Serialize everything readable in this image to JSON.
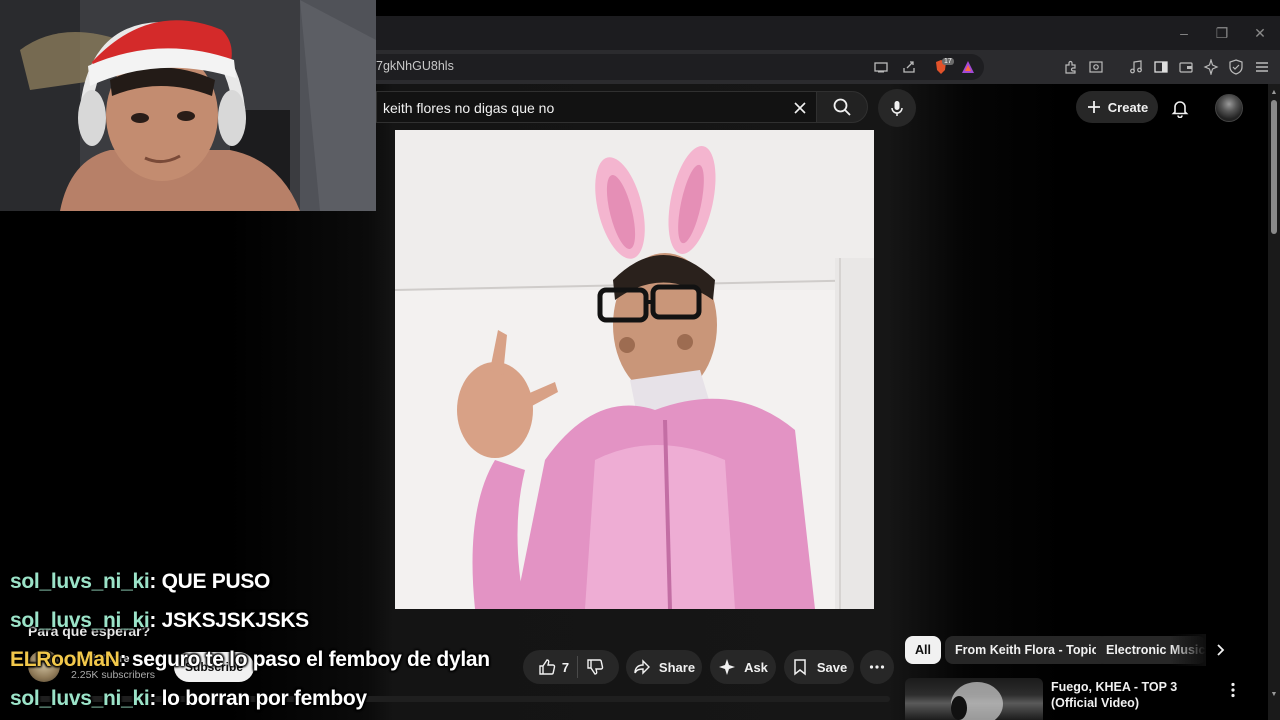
{
  "browser": {
    "url": "7gkNhGU8hls",
    "window_controls": [
      "–",
      "❐",
      "✕"
    ],
    "toolbar_icons": [
      "cast-icon",
      "share-icon",
      "brave-shields-icon",
      "brave-rewards-icon",
      "extensions-icon",
      "screenshot-icon",
      "music-icon",
      "sidebar-icon",
      "wallet-icon",
      "leo-ai-icon",
      "vpn-icon",
      "menu-icon"
    ],
    "brave_badge": "17"
  },
  "youtube": {
    "search_query": "keith flores no digas que no",
    "create_label": "Create",
    "video_pre_title": "Para qué esperar?",
    "channel_name": "Keith Flore",
    "channel_subs": "2.25K subscribers",
    "subscribe_label": "Subscribe",
    "actions": {
      "like_count": "7",
      "share_label": "Share",
      "ask_label": "Ask",
      "save_label": "Save"
    },
    "chips": [
      "All",
      "From Keith Flora - Topic",
      "Electronic Music"
    ],
    "recommendation": {
      "title": "Fuego, KHEA - TOP 3 (Official Video)"
    }
  },
  "chat": [
    {
      "user": "sol_luvs_ni_ki",
      "message": ": QUE PUSO",
      "user_color": "#9be3c8"
    },
    {
      "user": "sol_luvs_ni_ki",
      "message": ": JSKSJSKJSKS",
      "user_color": "#9be3c8"
    },
    {
      "user": "ELRooMaN",
      "message": ": seguro te lo paso el femboy de dylan",
      "user_color": "#f2c84b"
    },
    {
      "user": "sol_luvs_ni_ki",
      "message": ": lo borran por femboy",
      "user_color": "#9be3c8"
    }
  ],
  "colors": {
    "page_bg": "#0f0f0f",
    "chip_active_bg": "#f1f1f1",
    "pill_bg": "#272727"
  }
}
